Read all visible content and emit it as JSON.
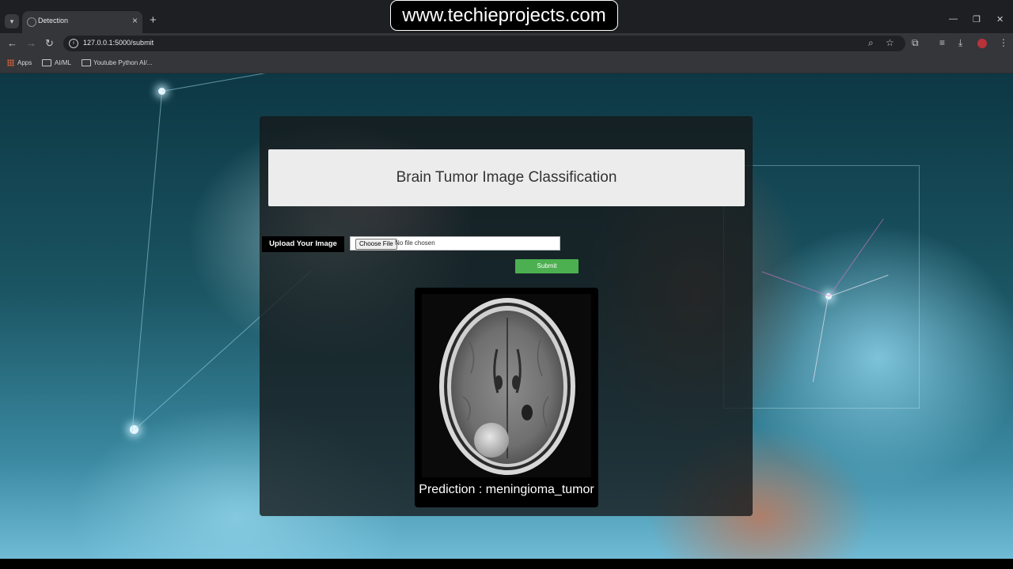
{
  "browser": {
    "tab_title": "Detection",
    "url": "127.0.0.1:5000/submit",
    "bookmarks": [
      "Apps",
      "AI/ML",
      "Youtube Python AI/..."
    ]
  },
  "watermark": "www.techieprojects.com",
  "app": {
    "title": "Brain Tumor Image Classification",
    "upload_label": "Upload Your Image",
    "choose_file_label": "Choose File",
    "no_file_text": "No file chosen",
    "submit_label": "Submit",
    "prediction_text": "Prediction : meningioma_tumor"
  },
  "colors": {
    "submit_green": "#4cb050",
    "header_box": "#ececec",
    "card_bg": "#16181a"
  }
}
